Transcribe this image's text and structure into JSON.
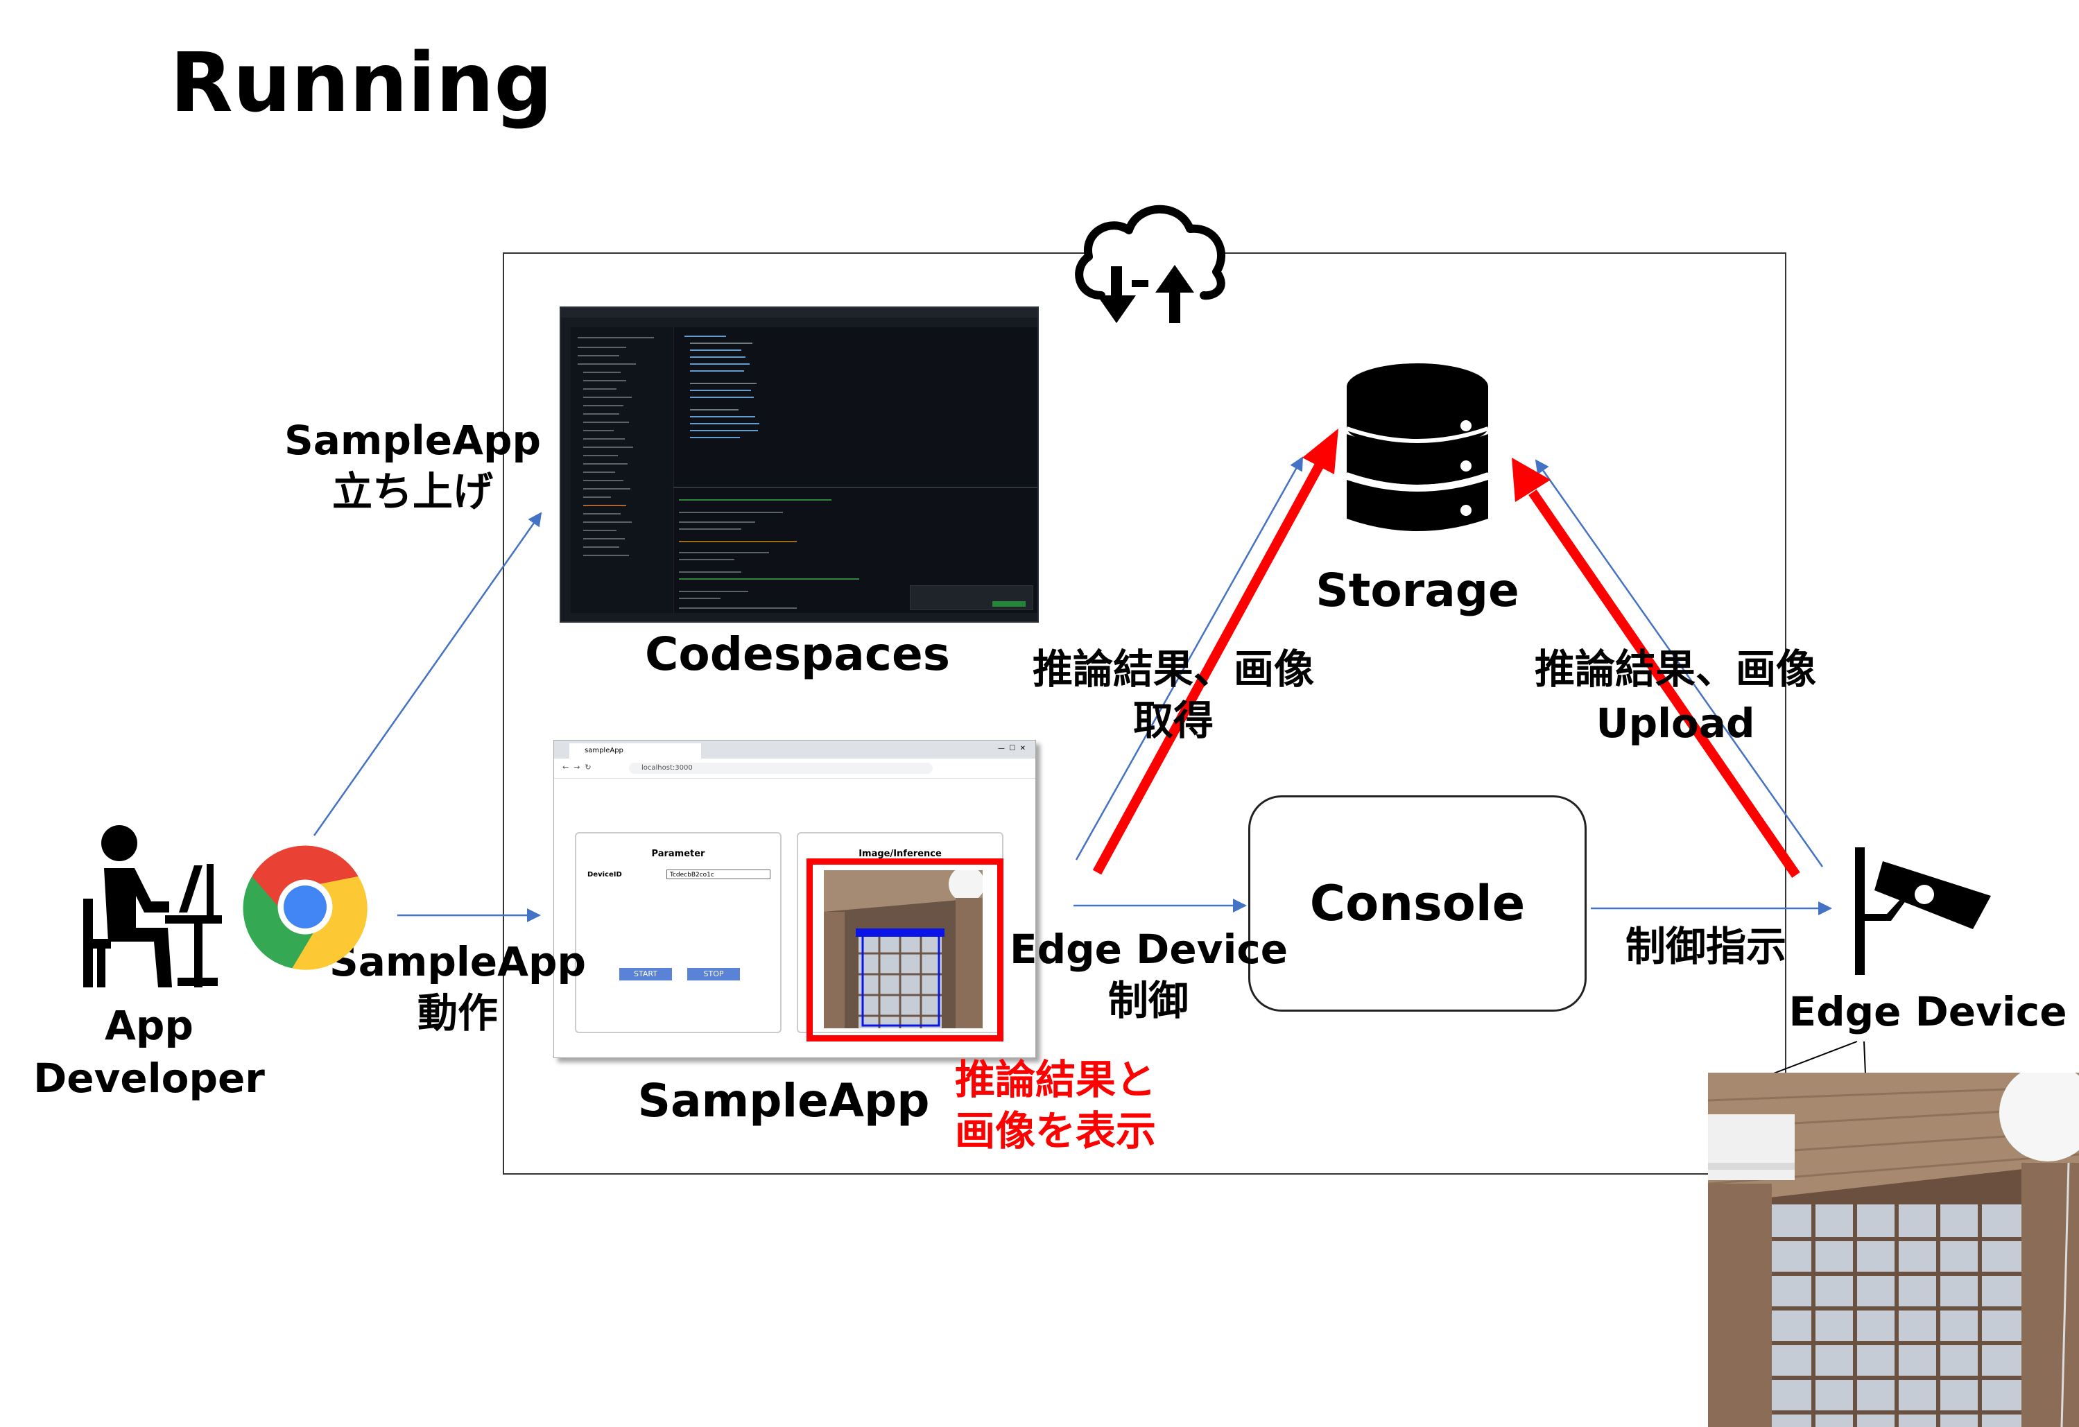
{
  "page": {
    "title": "Running"
  },
  "actors": {
    "developer_line1": "App",
    "developer_line2": "Developer",
    "edge_device": "Edge Device"
  },
  "components": {
    "codespaces": "Codespaces",
    "sampleapp": "SampleApp",
    "storage": "Storage",
    "console": "Console"
  },
  "flows": {
    "launch_line1": "SampleApp",
    "launch_line2": "立ち上げ",
    "operate_line1": "SampleApp",
    "operate_line2": "動作",
    "get_line1": "推論結果、画像",
    "get_line2": "取得",
    "upload_line1": "推論結果、画像",
    "upload_line2": "Upload",
    "edge_control_line1": "Edge Device",
    "edge_control_line2": "制御",
    "control_instruction": "制御指示",
    "display_line1": "推論結果と",
    "display_line2": "画像を表示"
  },
  "sampleapp_ui": {
    "tab_title": "sampleApp",
    "url": "localhost:3000",
    "parameter_heading": "Parameter",
    "device_id_label": "DeviceID",
    "device_id_value": "TcdecbB2co1c",
    "start_button": "START",
    "stop_button": "STOP",
    "image_heading": "Image/Inference"
  },
  "colors": {
    "red_accent": "#ff0000",
    "blue_arrow": "#4472c4",
    "dark": "#000000"
  },
  "icons": {
    "cloud": "cloud-sync-icon",
    "storage": "database-icon",
    "developer": "person-at-desk-icon",
    "browser": "chrome-icon",
    "camera": "surveillance-camera-icon"
  }
}
